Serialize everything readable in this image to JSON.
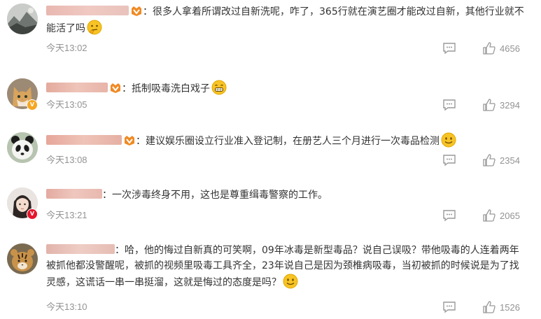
{
  "comments": [
    {
      "text": "：很多人拿着所谓改过自新洗呢，咋了，365行就在演艺圈才能改过自新，其他行业就不能活了吗",
      "time": "今天13:02",
      "likes": "4656",
      "avatar_icon": "mountain-landscape-avatar",
      "badge_icon": "fan-badge-icon",
      "emoji_icon": "thinking-emoji",
      "verified": false
    },
    {
      "text": "：抵制吸毒洗白戏子",
      "time": "今天13:05",
      "likes": "3294",
      "avatar_icon": "cat-avatar",
      "badge_icon": "fan-badge-icon",
      "emoji_icon": "grin-emoji",
      "verified": true,
      "verified_color": "#f5a623"
    },
    {
      "text": "：建议娱乐圈设立行业准入登记制，在册艺人三个月进行一次毒品检测",
      "time": "今天13:08",
      "likes": "2354",
      "avatar_icon": "panda-avatar",
      "badge_icon": "fan-badge-icon",
      "emoji_icon": "smile-emoji",
      "verified": false
    },
    {
      "text": "：一次涉毒终身不用，这也是尊重缉毒警察的工作。",
      "time": "今天13:21",
      "likes": "2065",
      "avatar_icon": "girl-avatar",
      "verified": true,
      "verified_color": "#e6162d"
    },
    {
      "text": "：哈，他的悔过自新真的可笑啊，09年冰毒是新型毒品？说自己误吸？带他吸毒的人连着两年被抓他都没警醒呢，被抓的视频里吸毒工具齐全，23年说自己是因为颈椎病吸毒，当初被抓的时候说是为了找灵感，这谎话一串一串挺溜，这就是悔过的态度是吗？",
      "time": "今天13:10",
      "likes": "1526",
      "avatar_icon": "tiger-avatar",
      "emoji_icon": "smile-emoji",
      "verified": false
    }
  ],
  "colors": {
    "time_text": "#939393",
    "body_text": "#333333",
    "icon_gray": "#999999",
    "emoji_yellow": "#f7c325"
  }
}
